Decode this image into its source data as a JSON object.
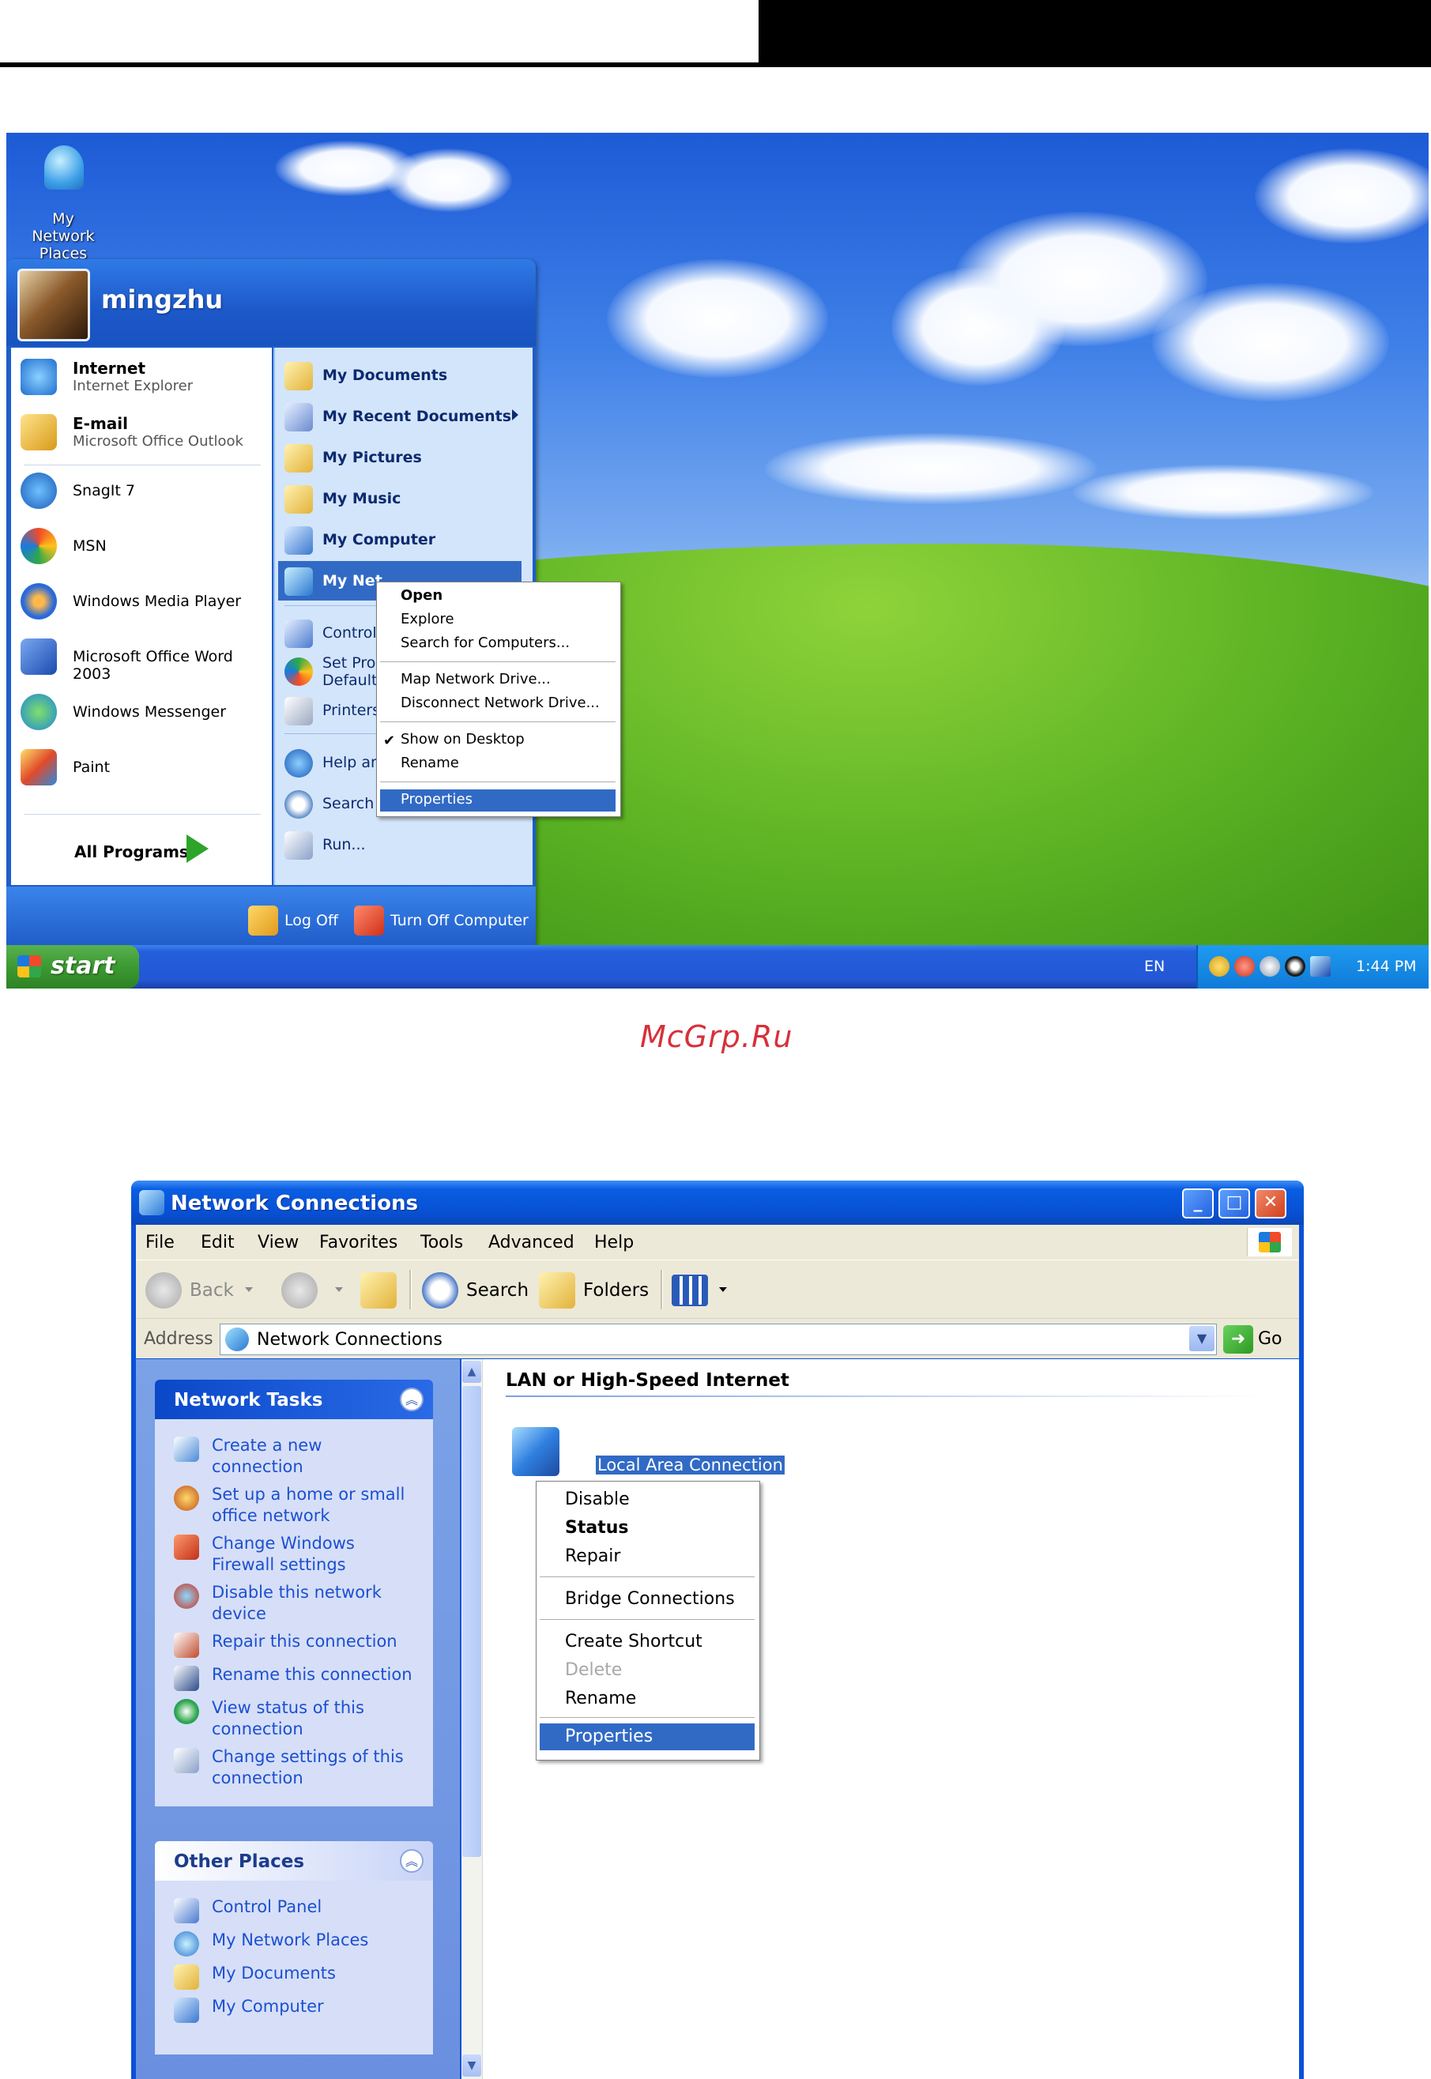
{
  "desktop": {
    "icon": {
      "label_line1": "My Network",
      "label_line2": "Places"
    },
    "start_menu": {
      "user": "mingzhu",
      "pinned": [
        {
          "title": "Internet",
          "subtitle": "Internet Explorer"
        },
        {
          "title": "E-mail",
          "subtitle": "Microsoft Office Outlook"
        }
      ],
      "recent": [
        "SnagIt 7",
        "MSN",
        "Windows Media Player",
        "Microsoft Office Word 2003",
        "Windows Messenger",
        "Paint"
      ],
      "all_programs": "All Programs",
      "places": [
        "My Documents",
        "My Recent Documents",
        "My Pictures",
        "My Music",
        "My Computer",
        "My Net"
      ],
      "system": [
        "Control P",
        "Set Prog",
        "Defaults",
        "Printers",
        "Help and",
        "Search",
        "Run..."
      ],
      "log_off": "Log Off",
      "turn_off": "Turn Off Computer"
    },
    "context_menu": {
      "items": [
        "Open",
        "Explore",
        "Search for Computers...",
        "Map Network Drive...",
        "Disconnect Network Drive...",
        "Show on Desktop",
        "Rename",
        "Properties"
      ],
      "checked_item": "Show on Desktop",
      "highlighted_item": "Properties"
    },
    "taskbar": {
      "start_label": "start",
      "language": "EN",
      "clock": "1:44 PM"
    }
  },
  "watermark": "McGrp.Ru",
  "network_window": {
    "title": "Network Connections",
    "menu": [
      "File",
      "Edit",
      "View",
      "Favorites",
      "Tools",
      "Advanced",
      "Help"
    ],
    "toolbar": {
      "back": "Back",
      "search": "Search",
      "folders": "Folders"
    },
    "address": {
      "label": "Address",
      "value": "Network Connections",
      "go": "Go"
    },
    "network_tasks": {
      "title": "Network Tasks",
      "items": [
        [
          "Create a new",
          "connection"
        ],
        [
          "Set up a home or small",
          "office network"
        ],
        [
          "Change Windows",
          "Firewall settings"
        ],
        [
          "Disable this network",
          "device"
        ],
        [
          "Repair this connection",
          ""
        ],
        [
          "Rename this connection",
          ""
        ],
        [
          "View status of this",
          "connection"
        ],
        [
          "Change settings of this",
          "connection"
        ]
      ]
    },
    "other_places": {
      "title": "Other Places",
      "items": [
        "Control Panel",
        "My Network Places",
        "My Documents",
        "My Computer"
      ]
    },
    "group_header": "LAN or High-Speed Internet",
    "connection_label": "Local Area Connection",
    "context_menu": {
      "items": [
        "Disable",
        "Status",
        "Repair",
        "Bridge Connections",
        "Create Shortcut",
        "Delete",
        "Rename",
        "Properties"
      ],
      "bold_item": "Status",
      "disabled_item": "Delete",
      "highlighted_item": "Properties"
    }
  }
}
